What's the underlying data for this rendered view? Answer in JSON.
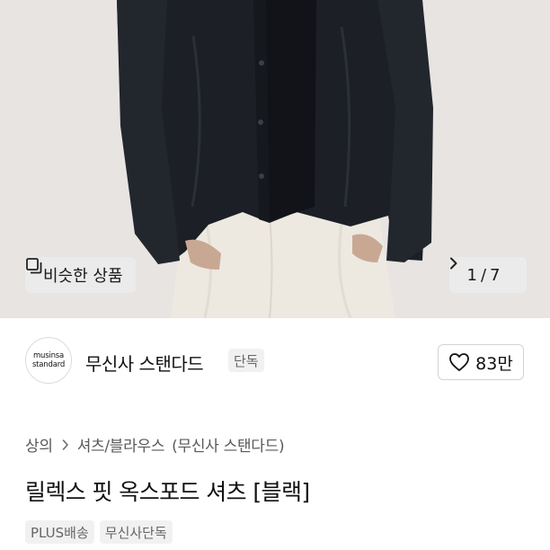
{
  "gallery": {
    "similar_label": "비슷한 상품",
    "similar_icon": "overlapping-squares-icon",
    "current": "1",
    "separator": "/",
    "total": "7",
    "next_icon": "chevron-right-icon"
  },
  "brand": {
    "logo_line1": "musinsa",
    "logo_line2": "standard",
    "name": "무신사 스탠다드",
    "badge": "단독",
    "likes": "83만",
    "like_icon": "heart-outline-icon"
  },
  "breadcrumb": {
    "category": "상의",
    "subcategory": "셔츠/블라우스",
    "brand": "(무신사 스탠다드)"
  },
  "product": {
    "title": "릴렉스 핏 옥스포드 셔츠 [블랙]",
    "tags": [
      "PLUS배송",
      "무신사단독"
    ]
  },
  "colors": {
    "text_primary": "#111111",
    "text_secondary": "#5a5a5a",
    "badge_bg": "#f1f1f1",
    "photo_bg": "#e7e4e1"
  }
}
